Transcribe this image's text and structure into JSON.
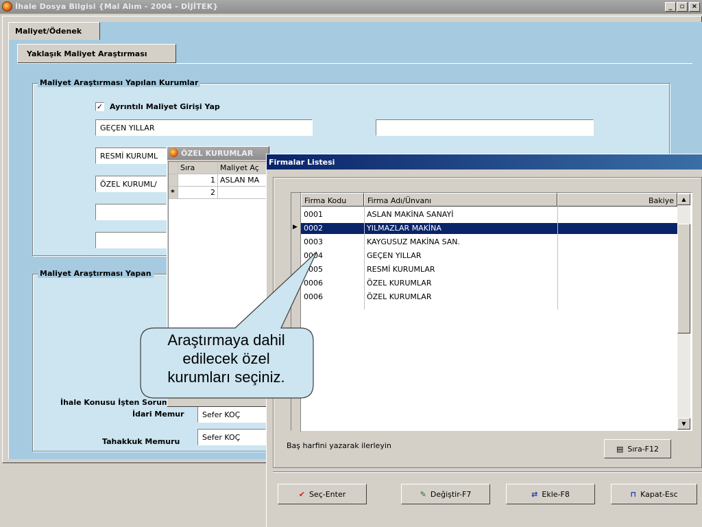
{
  "window": {
    "title": "İhale Dosya Bilgisi   {Mal Alım - 2004 - DİJİTEK}",
    "minimize": "_",
    "maximize": "▫",
    "close": "×"
  },
  "tabs": {
    "main": "Maliyet/Ödenek",
    "sub": "Yaklaşık Maliyet Araştırması"
  },
  "kurumlar_group": {
    "title": "Maliyet Araştırması Yapılan Kurumlar",
    "checkbox_label": "Ayrıntılı Maliyet Girişi Yap",
    "checkbox_mark": "✓",
    "fields": [
      "GEÇEN YILLAR",
      "RESMİ KURUML",
      "ÖZEL KURUML/",
      "",
      ""
    ],
    "right_field": ""
  },
  "yapan_group": {
    "title": "Maliyet Araştırması Yapan",
    "idari_label_line1": "İhale Konusu İşten Sorumlu",
    "idari_label_line2": "İdari Memur",
    "idari_value": "Sefer KOÇ",
    "tahakkuk_label": "Tahakkuk Memuru",
    "tahakkuk_value": "Sefer KOÇ"
  },
  "ozel_window": {
    "title": "ÖZEL KURUMLAR",
    "headers": [
      "Sıra",
      "Maliyet Aç"
    ],
    "rows": [
      {
        "marker": "",
        "sira": "1",
        "name": "ASLAN MA"
      },
      {
        "marker": "*",
        "sira": "2",
        "name": ""
      }
    ]
  },
  "firmalar": {
    "title": "Firmalar Listesi",
    "headers": {
      "code": "Firma Kodu",
      "name": "Firma Adı/Ünvanı",
      "balance": "Bakiye"
    },
    "rows": [
      {
        "code": "0001",
        "name": "ASLAN MAKİNA SANAYİ",
        "selected": false
      },
      {
        "code": "0002",
        "name": "YILMAZLAR MAKİNA",
        "selected": true
      },
      {
        "code": "0003",
        "name": "KAYGUSUZ MAKİNA SAN.",
        "selected": false
      },
      {
        "code": "0004",
        "name": "GEÇEN YILLAR",
        "selected": false
      },
      {
        "code": "0005",
        "name": "RESMİ KURUMLAR",
        "selected": false
      },
      {
        "code": "0006",
        "name": "ÖZEL KURUMLAR",
        "selected": false
      },
      {
        "code": "0006",
        "name": "ÖZEL KURUMLAR",
        "selected": false
      }
    ],
    "row_indicator": "▶",
    "hint": "Baş harfini yazarak ilerleyin",
    "sort_button": "Sıra-F12",
    "buttons": {
      "select": "Seç-Enter",
      "edit": "Değiştir-F7",
      "add": "Ekle-F8",
      "close": "Kapat-Esc"
    }
  },
  "callout": {
    "line1": "Araştırmaya dahil",
    "line2": "edilecek özel",
    "line3": "kurumları seçiniz."
  },
  "colors": {
    "accent": "#0a246a",
    "panel": "#a6cbe0",
    "group": "#cce5f0",
    "callout": "#cce5f0"
  }
}
